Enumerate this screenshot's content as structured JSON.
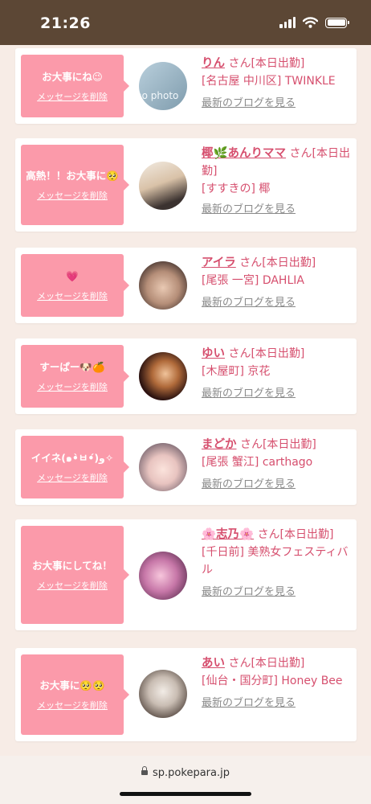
{
  "status_bar": {
    "time": "21:26"
  },
  "browser": {
    "url": "sp.pokepara.jp"
  },
  "messages": [
    {
      "message": "お大事にね😉",
      "delete_label": "メッセージを削除",
      "name": "りん",
      "suffix": "さん[本日出勤]",
      "shop": "[名古屋 中川区] TWINKLE",
      "blog_link": "最新のブログを見る",
      "avatar_text": "no photo"
    },
    {
      "message": "高熱！！お大事に🥺",
      "delete_label": "メッセージを削除",
      "name": "椰🌿あんりママ",
      "suffix": "さん[本日出勤]",
      "shop": "[すすきの] 椰",
      "blog_link": "最新のブログを見る"
    },
    {
      "message": "💗",
      "delete_label": "メッセージを削除",
      "name": "アイラ",
      "suffix": "さん[本日出勤]",
      "shop": "[尾張 一宮] DAHLIA",
      "blog_link": "最新のブログを見る"
    },
    {
      "message": "すーぱー🐶🍊",
      "delete_label": "メッセージを削除",
      "name": "ゆい",
      "suffix": "さん[本日出勤]",
      "shop": "[木屋町] 京花",
      "blog_link": "最新のブログを見る"
    },
    {
      "message": "イイネ(๑•̀ㅂ•́)و✧",
      "delete_label": "メッセージを削除",
      "name": "まどか",
      "suffix": "さん[本日出勤]",
      "shop": "[尾張 蟹江] carthago",
      "blog_link": "最新のブログを見る"
    },
    {
      "message": "お大事にしてね！",
      "delete_label": "メッセージを削除",
      "name": "🌸志乃🌸",
      "suffix": "さん[本日出勤]",
      "shop": "[千日前] 美熟女フェスティバル",
      "blog_link": "最新のブログを見る"
    },
    {
      "message": "お大事に🥺🥺",
      "delete_label": "メッセージを削除",
      "name": "あい",
      "suffix": "さん[本日出勤]",
      "shop": "[仙台・国分町] Honey Bee",
      "blog_link": "最新のブログを見る"
    }
  ]
}
